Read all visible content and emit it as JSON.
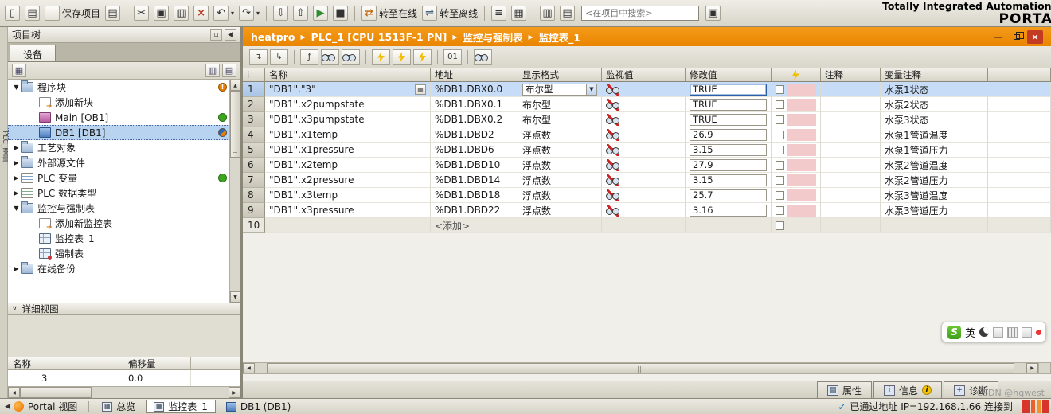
{
  "window": {
    "brand_line1": "Totally Integrated Automation",
    "brand_line2": "PORTAL"
  },
  "side_tab_label": "PLC_变量",
  "toolbar": {
    "search_placeholder": "<在项目中搜索>",
    "items": [
      {
        "icon": "new-project-icon"
      },
      {
        "icon": "open-project-icon"
      },
      {
        "icon": "save-project-icon",
        "text": "保存项目"
      },
      {
        "icon": "print-icon"
      },
      {
        "sep": true
      },
      {
        "icon": "cut-icon"
      },
      {
        "icon": "copy-icon"
      },
      {
        "icon": "paste-icon"
      },
      {
        "icon": "delete-icon"
      },
      {
        "icon": "undo-icon",
        "drop": true
      },
      {
        "icon": "redo-icon",
        "drop": true
      },
      {
        "sep": true
      },
      {
        "icon": "download-to-device-icon"
      },
      {
        "icon": "upload-from-device-icon"
      },
      {
        "icon": "start-cpu-icon"
      },
      {
        "icon": "stop-cpu-icon"
      },
      {
        "sep": true
      },
      {
        "icon": "go-online-icon",
        "text": "转至在线"
      },
      {
        "icon": "go-offline-icon",
        "text": "转至离线"
      },
      {
        "sep": true
      },
      {
        "icon": "accessible-devices-icon"
      },
      {
        "icon": "start-simulation-icon"
      },
      {
        "sep": true
      },
      {
        "icon": "horizontal-split-icon"
      },
      {
        "icon": "vertical-split-icon"
      },
      {
        "search": true
      },
      {
        "icon": "library-icon"
      }
    ]
  },
  "project_tree": {
    "title": "项目树",
    "tab_label": "设备",
    "items": [
      {
        "id": "program-blocks",
        "label": "程序块",
        "level": 0,
        "expander": "open",
        "icon": "folder",
        "badge": "warning"
      },
      {
        "id": "add-new-block",
        "label": "添加新块",
        "level": 1,
        "expander": "",
        "icon": "add"
      },
      {
        "id": "main-ob1",
        "label": "Main [OB1]",
        "level": 1,
        "expander": "",
        "icon": "ob",
        "badge": "green"
      },
      {
        "id": "db1",
        "label": "DB1 [DB1]",
        "level": 1,
        "expander": "",
        "icon": "db",
        "badge": "half",
        "selected": true
      },
      {
        "id": "technology-objects",
        "label": "工艺对象",
        "level": 0,
        "expander": "closed",
        "icon": "folder"
      },
      {
        "id": "external-sources",
        "label": "外部源文件",
        "level": 0,
        "expander": "closed",
        "icon": "folder"
      },
      {
        "id": "plc-tags",
        "label": "PLC 变量",
        "level": 0,
        "expander": "closed",
        "icon": "tag",
        "badge": "green"
      },
      {
        "id": "plc-datatypes",
        "label": "PLC 数据类型",
        "level": 0,
        "expander": "closed",
        "icon": "dt"
      },
      {
        "id": "watch-force-tables",
        "label": "监控与强制表",
        "level": 0,
        "expander": "open",
        "icon": "folder"
      },
      {
        "id": "add-watch-table",
        "label": "添加新监控表",
        "level": 1,
        "expander": "",
        "icon": "add"
      },
      {
        "id": "watch-table-1",
        "label": "监控表_1",
        "level": 1,
        "expander": "",
        "icon": "wt"
      },
      {
        "id": "force-table",
        "label": "强制表",
        "level": 1,
        "expander": "",
        "icon": "ft"
      },
      {
        "id": "online-backups",
        "label": "在线备份",
        "level": 0,
        "expander": "closed",
        "icon": "folder"
      }
    ],
    "details": {
      "title": "详细视图",
      "columns": [
        "名称",
        "偏移量"
      ],
      "row": {
        "name": "3",
        "offset": "0.0"
      }
    }
  },
  "breadcrumb": {
    "parts": [
      "heatpro",
      "PLC_1 [CPU 1513F-1 PN]",
      "监控与强制表",
      "监控表_1"
    ]
  },
  "watch_toolbar": {
    "items": [
      {
        "name": "insert-row-icon"
      },
      {
        "name": "add-row-icon"
      },
      {
        "sep": true
      },
      {
        "name": "trigger-settings-icon"
      },
      {
        "name": "monitor-all-icon"
      },
      {
        "name": "monitor-once-icon"
      },
      {
        "sep": true
      },
      {
        "name": "modify-selected-icon"
      },
      {
        "name": "modify-now-icon"
      },
      {
        "name": "modify-with-trigger-icon"
      },
      {
        "sep": true
      },
      {
        "name": "show-columns-icon"
      },
      {
        "sep": true
      },
      {
        "name": "watch-all-icon"
      }
    ]
  },
  "watch_table": {
    "columns": {
      "index": "i",
      "name": "名称",
      "address": "地址",
      "format": "显示格式",
      "monitor": "监视值",
      "modify": "修改值",
      "comment": "注释",
      "tag_comment": "变量注释"
    },
    "rows": [
      {
        "i": "1",
        "name": "\"DB1\".\"3\"",
        "address": "%DB1.DBX0.0",
        "format": "布尔型",
        "modify": "TRUE",
        "tag_comment": "水泵1状态",
        "selected": true
      },
      {
        "i": "2",
        "name": "\"DB1\".x2pumpstate",
        "address": "%DB1.DBX0.1",
        "format": "布尔型",
        "modify": "TRUE",
        "tag_comment": "水泵2状态"
      },
      {
        "i": "3",
        "name": "\"DB1\".x3pumpstate",
        "address": "%DB1.DBX0.2",
        "format": "布尔型",
        "modify": "TRUE",
        "tag_comment": "水泵3状态"
      },
      {
        "i": "4",
        "name": "\"DB1\".x1temp",
        "address": "%DB1.DBD2",
        "format": "浮点数",
        "modify": "26.9",
        "tag_comment": "水泵1管道温度"
      },
      {
        "i": "5",
        "name": "\"DB1\".x1pressure",
        "address": "%DB1.DBD6",
        "format": "浮点数",
        "modify": "3.15",
        "tag_comment": "水泵1管道压力"
      },
      {
        "i": "6",
        "name": "\"DB1\".x2temp",
        "address": "%DB1.DBD10",
        "format": "浮点数",
        "modify": "27.9",
        "tag_comment": "水泵2管道温度"
      },
      {
        "i": "7",
        "name": "\"DB1\".x2pressure",
        "address": "%DB1.DBD14",
        "format": "浮点数",
        "modify": "3.15",
        "tag_comment": "水泵2管道压力"
      },
      {
        "i": "8",
        "name": "\"DB1\".x3temp",
        "address": "%DB1.DBD18",
        "format": "浮点数",
        "modify": "25.7",
        "tag_comment": "水泵3管道温度"
      },
      {
        "i": "9",
        "name": "\"DB1\".x3pressure",
        "address": "%DB1.DBD22",
        "format": "浮点数",
        "modify": "3.16",
        "tag_comment": "水泵3管道压力"
      },
      {
        "i": "10",
        "address": "<添加>",
        "placeholder": true
      }
    ]
  },
  "bottom_tabs": [
    {
      "id": "properties",
      "label": "属性",
      "icon": "properties-icon"
    },
    {
      "id": "info",
      "label": "信息",
      "icon": "info-icon",
      "badge": "i"
    },
    {
      "id": "diagnostics",
      "label": "诊断",
      "icon": "diagnostics-icon"
    }
  ],
  "status_bar": {
    "back_label": "Portal 视图",
    "tabs": [
      {
        "id": "overview",
        "label": "总览",
        "icon": "overview-icon"
      },
      {
        "id": "watch-table-1",
        "label": "监控表_1",
        "icon": "watch-table-icon",
        "active": true
      },
      {
        "id": "db1",
        "label": "DB1 (DB1)",
        "icon": "db-block-icon"
      }
    ],
    "connection": "已通过地址 IP=192.168.1.66 连接到"
  },
  "ime": {
    "logo": "S",
    "lang": "英"
  },
  "watermark": "CSDN @hqwest"
}
